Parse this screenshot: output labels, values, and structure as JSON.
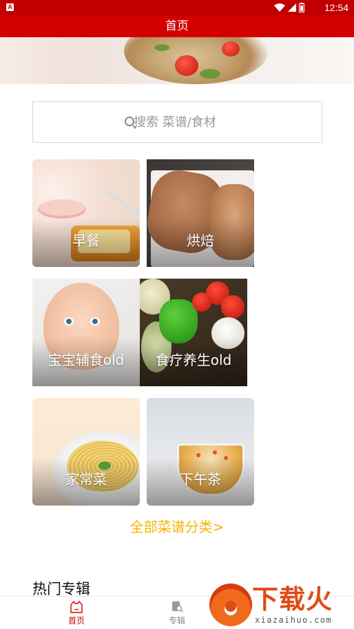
{
  "status_bar": {
    "app_badge": "A",
    "time": "12:54",
    "icons": [
      "wifi-icon",
      "signal-icon",
      "battery-icon"
    ]
  },
  "header": {
    "title": "首页"
  },
  "search": {
    "placeholder": "搜索 菜谱/食材"
  },
  "categories": [
    {
      "label": "早餐"
    },
    {
      "label": "烘焙"
    },
    {
      "label": "宝宝辅食old"
    },
    {
      "label": "食疗养生old"
    },
    {
      "label": "家常菜"
    },
    {
      "label": "下午茶"
    }
  ],
  "all_categories_link": "全部菜谱分类>",
  "hot_section": {
    "title": "热门专辑"
  },
  "bottom_nav": [
    {
      "label": "首页",
      "icon": "home-icon",
      "active": true
    },
    {
      "label": "专辑",
      "icon": "album-search-icon",
      "active": false
    }
  ],
  "watermark": {
    "name": "下载火",
    "url": "xiazaihuo.com"
  },
  "colors": {
    "status_bar": "#c10000",
    "title_bar": "#d40000",
    "accent_yellow": "#f5b400",
    "nav_active": "#d40000",
    "brand_orange": "#e24a14"
  }
}
